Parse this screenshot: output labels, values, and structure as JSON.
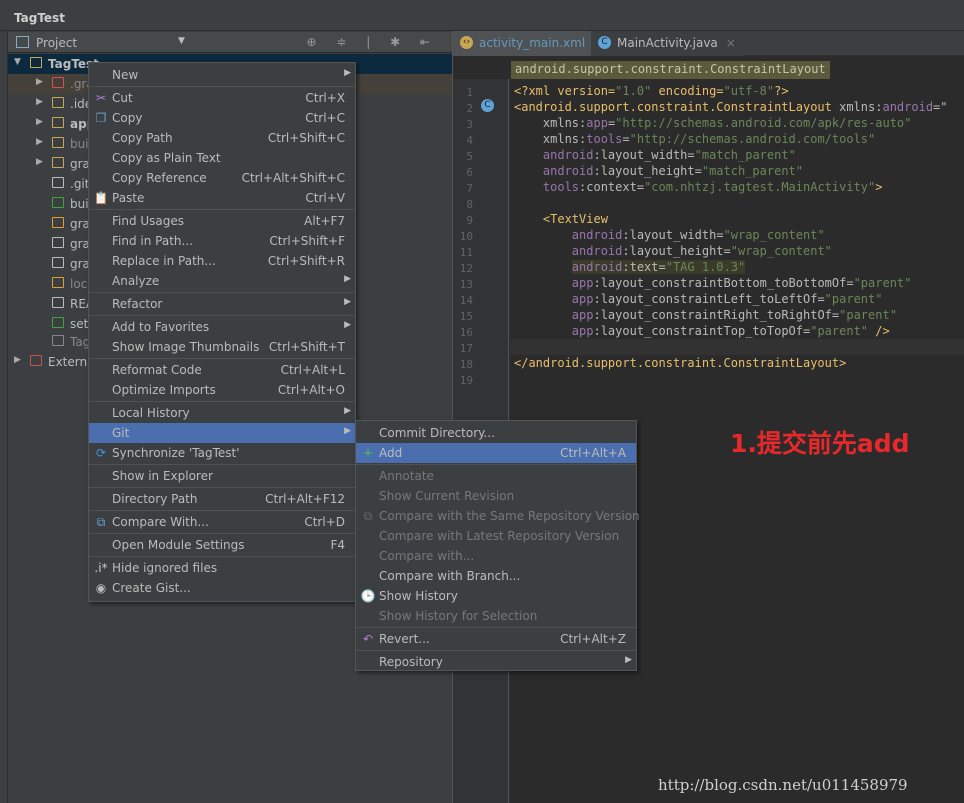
{
  "window": {
    "breadcrumb": "TagTest"
  },
  "project_panel": {
    "title": "Project",
    "toolbar_icons": [
      "target-icon",
      "collapse-icon",
      "gear-icon",
      "hide-icon"
    ],
    "tree": [
      {
        "label": "TagTest",
        "depth": 0,
        "expand": "▼",
        "bold": true,
        "selected": true,
        "icon_color": "#c9a654"
      },
      {
        "label": ".gra",
        "depth": 1,
        "expand": "▶",
        "dim": true,
        "icon_color": "#d25252",
        "hover": true
      },
      {
        "label": ".ide",
        "depth": 1,
        "expand": "▶",
        "icon_color": "#c9a654"
      },
      {
        "label": "app",
        "depth": 1,
        "expand": "▶",
        "bold": true,
        "icon_color": "#c9a654"
      },
      {
        "label": "buil",
        "depth": 1,
        "expand": "▶",
        "dim": true,
        "icon_color": "#c9a654"
      },
      {
        "label": "grac",
        "depth": 1,
        "expand": "▶",
        "icon_color": "#c9a654"
      },
      {
        "label": ".giti",
        "depth": 1,
        "icon_color": "#bbbbbb"
      },
      {
        "label": "buil",
        "depth": 1,
        "icon_color": "#3fa33f"
      },
      {
        "label": "grac",
        "depth": 1,
        "icon_color": "#e0a030"
      },
      {
        "label": "grac",
        "depth": 1,
        "icon_color": "#bbbbbb"
      },
      {
        "label": "grac",
        "depth": 1,
        "icon_color": "#bbbbbb"
      },
      {
        "label": "loca",
        "depth": 1,
        "dim": true,
        "icon_color": "#e0a030"
      },
      {
        "label": "REA",
        "depth": 1,
        "icon_color": "#bbbbbb"
      },
      {
        "label": "setti",
        "depth": 1,
        "icon_color": "#3fa33f"
      },
      {
        "label": "Tag",
        "depth": 1,
        "dim": true,
        "icon_color": "#888888"
      },
      {
        "label": "Externa",
        "depth": 0,
        "expand": "▶",
        "icon_color": "#c75450"
      }
    ]
  },
  "editor": {
    "tabs": [
      {
        "label": "activity_main.xml",
        "active": true,
        "icon": "xml-icon",
        "color": "#6897bb"
      },
      {
        "label": "MainActivity.java",
        "active": false,
        "icon": "class-icon",
        "color": "#bbbbbb"
      }
    ],
    "breadcrumb": "android.support.constraint.ConstraintLayout",
    "lines": [
      [
        [
          "<?xml version=",
          "k-tag"
        ],
        [
          "\"1.0\"",
          "k-val"
        ],
        [
          " encoding=",
          "k-tag"
        ],
        [
          "\"utf-8\"",
          "k-val"
        ],
        [
          "?>",
          "k-tag"
        ]
      ],
      [
        [
          "<android.support.constraint.ConstraintLayout ",
          "k-tag"
        ],
        [
          "xmlns:",
          "k-attr"
        ],
        [
          "android",
          "k-ns"
        ],
        [
          "=\"",
          "k-attr"
        ]
      ],
      [
        [
          "    xmlns:",
          "k-attr"
        ],
        [
          "app",
          "k-ns"
        ],
        [
          "=",
          "k-attr"
        ],
        [
          "\"http://schemas.android.com/apk/res-auto\"",
          "k-val"
        ]
      ],
      [
        [
          "    xmlns:",
          "k-attr"
        ],
        [
          "tools",
          "k-ns"
        ],
        [
          "=",
          "k-attr"
        ],
        [
          "\"http://schemas.android.com/tools\"",
          "k-val"
        ]
      ],
      [
        [
          "    ",
          "k-plain"
        ],
        [
          "android",
          "k-ns"
        ],
        [
          ":layout_width=",
          "k-attr"
        ],
        [
          "\"match_parent\"",
          "k-val"
        ]
      ],
      [
        [
          "    ",
          "k-plain"
        ],
        [
          "android",
          "k-ns"
        ],
        [
          ":layout_height=",
          "k-attr"
        ],
        [
          "\"match_parent\"",
          "k-val"
        ]
      ],
      [
        [
          "    ",
          "k-plain"
        ],
        [
          "tools",
          "k-ns"
        ],
        [
          ":context=",
          "k-attr"
        ],
        [
          "\"com.nhtzj.tagtest.MainActivity\"",
          "k-val"
        ],
        [
          ">",
          "k-tag"
        ]
      ],
      [],
      [
        [
          "    <TextView",
          "k-tag"
        ]
      ],
      [
        [
          "        ",
          "k-plain"
        ],
        [
          "android",
          "k-ns"
        ],
        [
          ":layout_width=",
          "k-attr"
        ],
        [
          "\"wrap_content\"",
          "k-val"
        ]
      ],
      [
        [
          "        ",
          "k-plain"
        ],
        [
          "android",
          "k-ns"
        ],
        [
          ":layout_height=",
          "k-attr"
        ],
        [
          "\"wrap_content\"",
          "k-val"
        ]
      ],
      [
        [
          "        ",
          "k-plain"
        ],
        [
          "android",
          "k-ns"
        ],
        [
          ":text=",
          "k-attr"
        ],
        [
          "\"TAG 1.0.3\"",
          "k-val"
        ]
      ],
      [
        [
          "        ",
          "k-plain"
        ],
        [
          "app",
          "k-ns"
        ],
        [
          ":layout_constraintBottom_toBottomOf=",
          "k-attr"
        ],
        [
          "\"parent\"",
          "k-val"
        ]
      ],
      [
        [
          "        ",
          "k-plain"
        ],
        [
          "app",
          "k-ns"
        ],
        [
          ":layout_constraintLeft_toLeftOf=",
          "k-attr"
        ],
        [
          "\"parent\"",
          "k-val"
        ]
      ],
      [
        [
          "        ",
          "k-plain"
        ],
        [
          "app",
          "k-ns"
        ],
        [
          ":layout_constraintRight_toRightOf=",
          "k-attr"
        ],
        [
          "\"parent\"",
          "k-val"
        ]
      ],
      [
        [
          "        ",
          "k-plain"
        ],
        [
          "app",
          "k-ns"
        ],
        [
          ":layout_constraintTop_toTopOf=",
          "k-attr"
        ],
        [
          "\"parent\"",
          "k-val"
        ],
        [
          " />",
          "k-tag"
        ]
      ],
      [],
      [
        [
          "</android.support.constraint.ConstraintLayout>",
          "k-tag"
        ]
      ],
      []
    ],
    "line_numbers": [
      "1",
      "2",
      "3",
      "4",
      "5",
      "6",
      "7",
      "8",
      "9",
      "10",
      "11",
      "12",
      "13",
      "14",
      "15",
      "16",
      "17",
      "18",
      "19"
    ],
    "highlighted_line": 12,
    "caret_line": 17
  },
  "context_menu": [
    {
      "label": "New",
      "submenu": true
    },
    "sep",
    {
      "label": "Cut",
      "shortcut": "Ctrl+X",
      "icon": "cut-icon",
      "glyph": "✂",
      "glyph_color": "#b07fd0"
    },
    {
      "label": "Copy",
      "shortcut": "Ctrl+C",
      "icon": "copy-icon",
      "glyph": "❐",
      "glyph_color": "#6a9fd0"
    },
    {
      "label": "Copy Path",
      "shortcut": "Ctrl+Shift+C"
    },
    {
      "label": "Copy as Plain Text"
    },
    {
      "label": "Copy Reference",
      "shortcut": "Ctrl+Alt+Shift+C"
    },
    {
      "label": "Paste",
      "shortcut": "Ctrl+V",
      "icon": "paste-icon",
      "glyph": "📋",
      "glyph_color": "#c9a654"
    },
    "sep",
    {
      "label": "Find Usages",
      "shortcut": "Alt+F7"
    },
    {
      "label": "Find in Path...",
      "shortcut": "Ctrl+Shift+F"
    },
    {
      "label": "Replace in Path...",
      "shortcut": "Ctrl+Shift+R"
    },
    {
      "label": "Analyze",
      "submenu": true
    },
    "sep",
    {
      "label": "Refactor",
      "submenu": true
    },
    "sep",
    {
      "label": "Add to Favorites",
      "submenu": true
    },
    {
      "label": "Show Image Thumbnails",
      "shortcut": "Ctrl+Shift+T"
    },
    "sep",
    {
      "label": "Reformat Code",
      "shortcut": "Ctrl+Alt+L"
    },
    {
      "label": "Optimize Imports",
      "shortcut": "Ctrl+Alt+O"
    },
    "sep",
    {
      "label": "Local History",
      "submenu": true
    },
    {
      "label": "Git",
      "submenu": true,
      "highlighted": true
    },
    {
      "label": "Synchronize 'TagTest'",
      "icon": "sync-icon",
      "glyph": "⟳",
      "glyph_color": "#4a8fd8"
    },
    "sep",
    {
      "label": "Show in Explorer"
    },
    "sep",
    {
      "label": "Directory Path",
      "shortcut": "Ctrl+Alt+F12"
    },
    "sep",
    {
      "label": "Compare With...",
      "shortcut": "Ctrl+D",
      "icon": "compare-icon",
      "glyph": "⧉",
      "glyph_color": "#6a9fd0"
    },
    "sep",
    {
      "label": "Open Module Settings",
      "shortcut": "F4"
    },
    "sep",
    {
      "label": "Hide ignored files",
      "icon": "ignored-files-icon",
      "glyph": ".i*",
      "glyph_color": "#cccccc"
    },
    {
      "label": "Create Gist...",
      "icon": "github-icon",
      "glyph": "◉",
      "glyph_color": "#bbbbbb"
    }
  ],
  "git_submenu": [
    {
      "label": "Commit Directory..."
    },
    {
      "label": "Add",
      "shortcut": "Ctrl+Alt+A",
      "highlighted": true,
      "icon": "plus-icon",
      "glyph": "+",
      "glyph_color": "#4fc24f"
    },
    "sep",
    {
      "label": "Annotate",
      "disabled": true
    },
    {
      "label": "Show Current Revision",
      "disabled": true
    },
    {
      "label": "Compare with the Same Repository Version",
      "disabled": true,
      "icon": "compare-icon",
      "glyph": "⧉",
      "glyph_color": "#666666"
    },
    {
      "label": "Compare with Latest Repository Version",
      "disabled": true
    },
    {
      "label": "Compare with...",
      "disabled": true
    },
    {
      "label": "Compare with Branch..."
    },
    {
      "label": "Show History",
      "icon": "history-icon",
      "glyph": "🕒",
      "glyph_color": "#6a9fd0"
    },
    {
      "label": "Show History for Selection",
      "disabled": true
    },
    "sep",
    {
      "label": "Revert...",
      "shortcut": "Ctrl+Alt+Z",
      "icon": "revert-icon",
      "glyph": "↶",
      "glyph_color": "#b07fd0"
    },
    "sep",
    {
      "label": "Repository",
      "submenu": true
    }
  ],
  "annotation": "1.提交前先add",
  "watermark": "http://blog.csdn.net/u011458979",
  "colors": {
    "menu_highlight": "#4b6eaf",
    "annotation": "#e8282b",
    "editor_bg": "#2b2b2b",
    "panel_bg": "#3c3f41"
  }
}
